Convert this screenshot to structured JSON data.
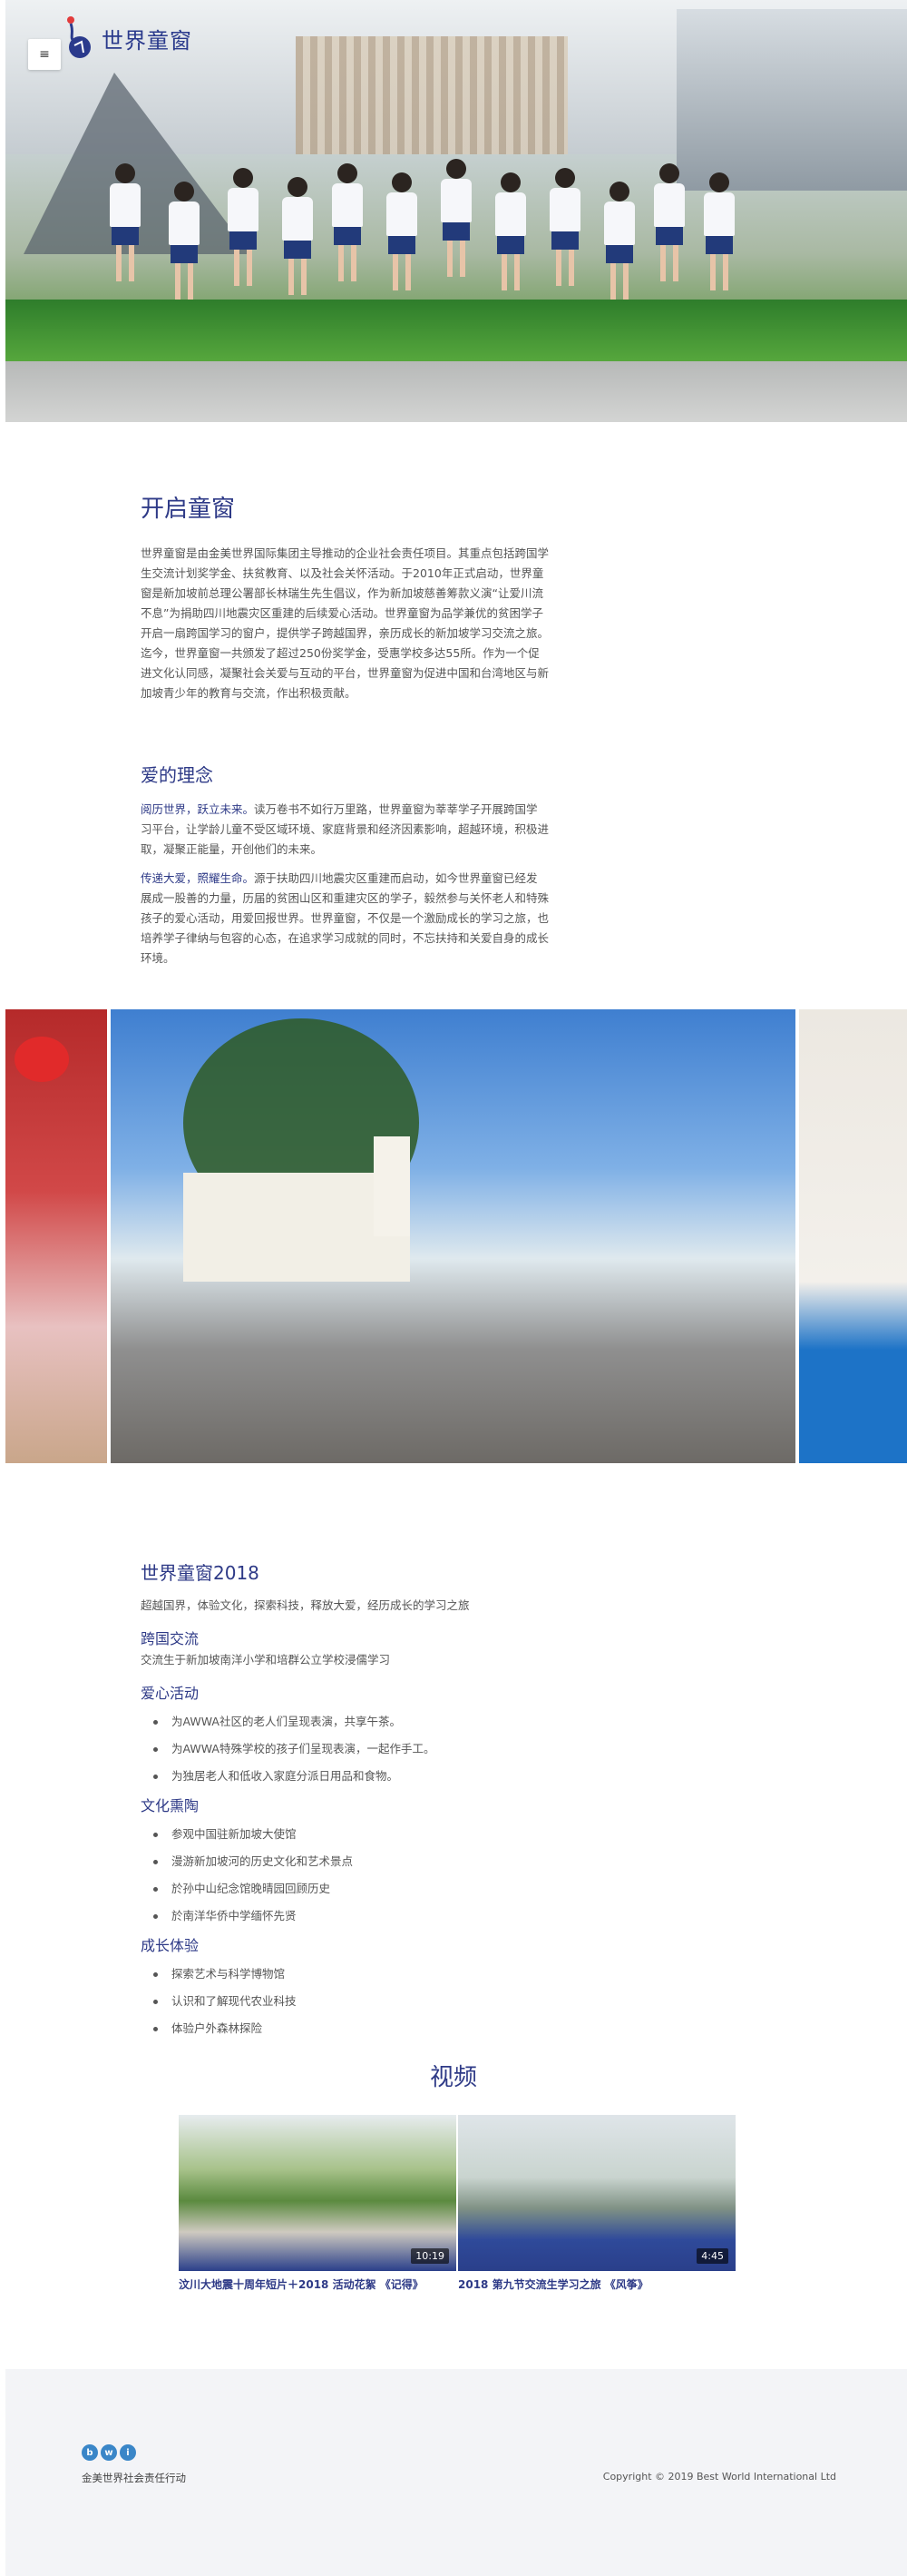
{
  "header": {
    "menu_icon": "hamburger-icon",
    "logo_text": "世界童窗"
  },
  "intro": {
    "title": "开启童窗",
    "paragraph": "世界童窗是由金美世界国际集团主导推动的企业社会责任项目。其重点包括跨国学生交流计划奖学金、扶贫教育、以及社会关怀活动。于2010年正式启动，世界童窗是新加坡前总理公署部长林瑞生先生倡议，作为新加坡慈善筹款义演“让爱川流不息”为捐助四川地震灾区重建的后续爱心活动。世界童窗为品学兼优的贫困学子开启一扇跨国学习的窗户，提供学子跨越国界，亲历成长的新加坡学习交流之旅。迄今，世界童窗一共颁发了超过250份奖学金，受惠学校多达55所。作为一个促进文化认同感，凝聚社会关爱与互动的平台，世界童窗为促进中国和台湾地区与新加坡青少年的教育与交流，作出积极贡献。"
  },
  "philosophy": {
    "title": "爱的理念",
    "p1_lead": "阅历世界，跃立未来。",
    "p1_body": "读万卷书不如行万里路，世界童窗为莘莘学子开展跨国学习平台，让学龄儿童不受区域环境、家庭背景和经济因素影响，超越环境，积极进取，凝聚正能量，开创他们的未来。",
    "p2_lead": "传递大爱，照耀生命。",
    "p2_body": "源于扶助四川地震灾区重建而启动，如今世界童窗已经发展成一股善的力量，历届的贫困山区和重建灾区的学子，毅然参与关怀老人和特殊孩子的爱心活动，用爱回报世界。世界童窗，不仅是一个激励成长的学习之旅，也培养学子律纳与包容的心态，在追求学习成就的同时，不忘扶持和关爱自身的成长环境。"
  },
  "program": {
    "title": "世界童窗2018",
    "tagline": "超越国界，体验文化，探索科技，释放大爱，经历成长的学习之旅",
    "groups": [
      {
        "heading": "跨国交流",
        "text": "交流生于新加坡南洋小学和培群公立学校浸儒学习",
        "items": []
      },
      {
        "heading": "爱心活动",
        "text": "",
        "items": [
          "为AWWA社区的老人们呈现表演，共享午茶。",
          "为AWWA特殊学校的孩子们呈现表演，一起作手工。",
          "为独居老人和低收入家庭分派日用品和食物。"
        ]
      },
      {
        "heading": "文化熏陶",
        "text": "",
        "items": [
          "参观中国驻新加坡大使馆",
          "漫游新加坡河的历史文化和艺术景点",
          "於孙中山纪念馆晚晴园回顾历史",
          "於南洋华侨中学缅怀先贤"
        ]
      },
      {
        "heading": "成长体验",
        "text": "",
        "items": [
          "探索艺术与科学博物馆",
          "认识和了解现代农业科技",
          "体验户外森林探险"
        ]
      }
    ]
  },
  "videos": {
    "heading": "视频",
    "items": [
      {
        "title": "汶川大地震十周年短片＋2018 活动花絮 《记得》",
        "duration": "10:19"
      },
      {
        "title": "2018 第九节交流生学习之旅 《风筝》",
        "duration": "4:45"
      }
    ]
  },
  "footer": {
    "logo_letters": [
      "b",
      "w",
      "i"
    ],
    "org_name": "金美世界社会责任行动",
    "copyright": "Copyright © 2019 Best World International Ltd"
  },
  "colors": {
    "accent": "#2e3a87",
    "body_text": "#555555",
    "footer_bg": "#f3f4f7"
  }
}
